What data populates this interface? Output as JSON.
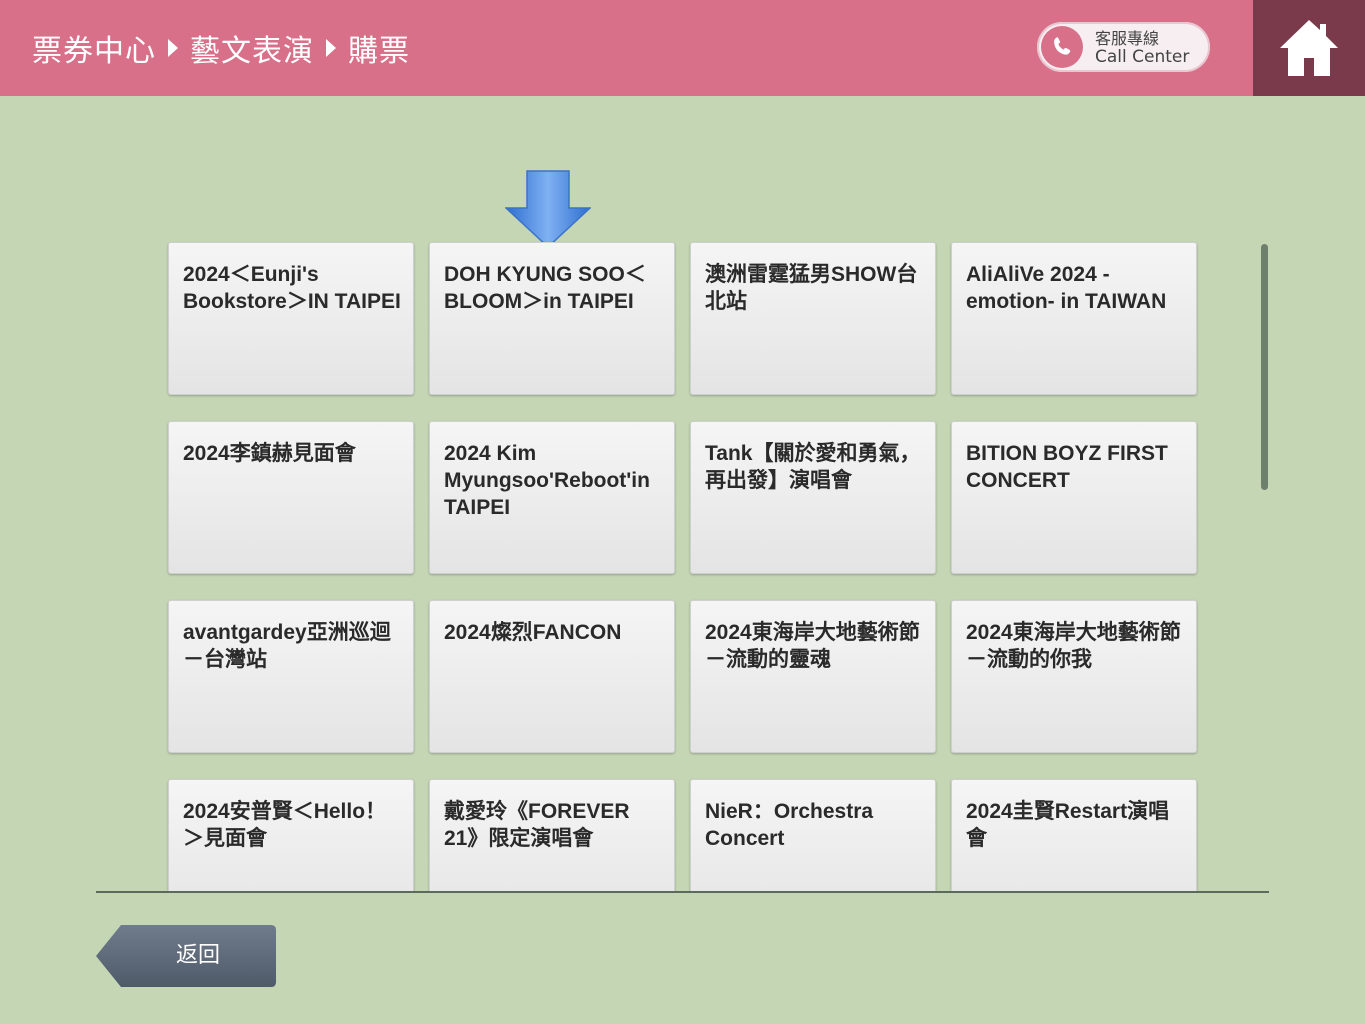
{
  "header": {
    "breadcrumb": [
      "票券中心",
      "藝文表演",
      "購票"
    ],
    "call_center": {
      "line1": "客服專線",
      "line2": "Call Center"
    }
  },
  "colors": {
    "header": "#d8708a",
    "home_button": "#7a3a4c",
    "background": "#c5d6b5",
    "back_button": "#5f6b7a",
    "arrow": "#4a86e0"
  },
  "events": [
    "2024＜Eunji's Bookstore＞IN TAIPEI",
    "DOH KYUNG SOO＜BLOOM＞in TAIPEI",
    "澳洲雷霆猛男SHOW台北站",
    "AliAliVe 2024 -emotion- in TAIWAN",
    "2024李鎮赫見面會",
    "2024 Kim Myungsoo'Reboot'in TAIPEI",
    "Tank【關於愛和勇氣，再出發】演唱會",
    "BITION BOYZ FIRST CONCERT",
    "avantgardey亞洲巡迴－台灣站",
    "2024燦烈FANCON",
    "2024東海岸大地藝術節－流動的靈魂",
    "2024東海岸大地藝術節－流動的你我",
    "2024安普賢＜Hello！＞見面會",
    "戴愛玲《FOREVER 21》限定演唱會",
    "NieR：Orchestra Concert",
    "2024圭賢Restart演唱會"
  ],
  "footer": {
    "back_label": "返回"
  }
}
